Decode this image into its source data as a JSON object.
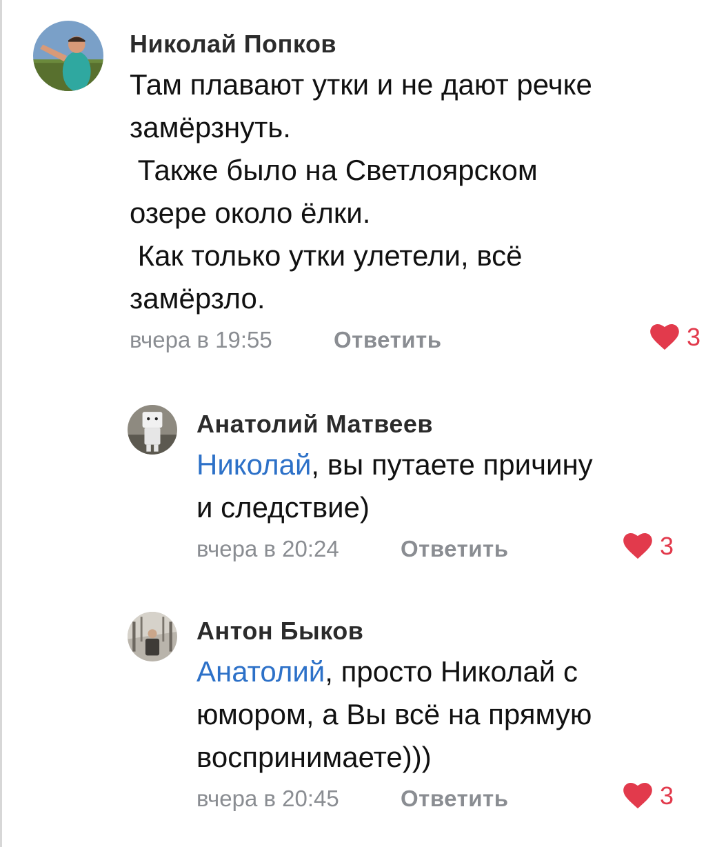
{
  "colors": {
    "mention": "#2d71c8",
    "like": "#e23a4c",
    "meta": "#8a8d92"
  },
  "comments": [
    {
      "author": "Николай Попков",
      "avatar_icon": "user-avatar-photo",
      "text_lines": [
        "Там плавают утки и не дают речке",
        "замёрзнуть.",
        " Также было на Светлоярском",
        "озере около ёлки.",
        " Как только утки улетели, всё",
        "замёрзло."
      ],
      "time": "вчера в 19:55",
      "reply_label": "Ответить",
      "likes": "3",
      "like_icon": "heart-icon"
    },
    {
      "author": "Анатолий Матвеев",
      "avatar_icon": "user-avatar-photo",
      "mention": "Николай",
      "text_lines": [
        ", вы путаете причину",
        "и следствие)"
      ],
      "time": "вчера в 20:24",
      "reply_label": "Ответить",
      "likes": "3",
      "like_icon": "heart-icon"
    },
    {
      "author": "Антон Быков",
      "avatar_icon": "user-avatar-photo",
      "mention": "Анатолий",
      "text_lines": [
        ", просто Николай с",
        "юмором, а Вы всё на прямую",
        "воспринимаете)))"
      ],
      "time": "вчера в 20:45",
      "reply_label": "Ответить",
      "likes": "3",
      "like_icon": "heart-icon"
    }
  ]
}
